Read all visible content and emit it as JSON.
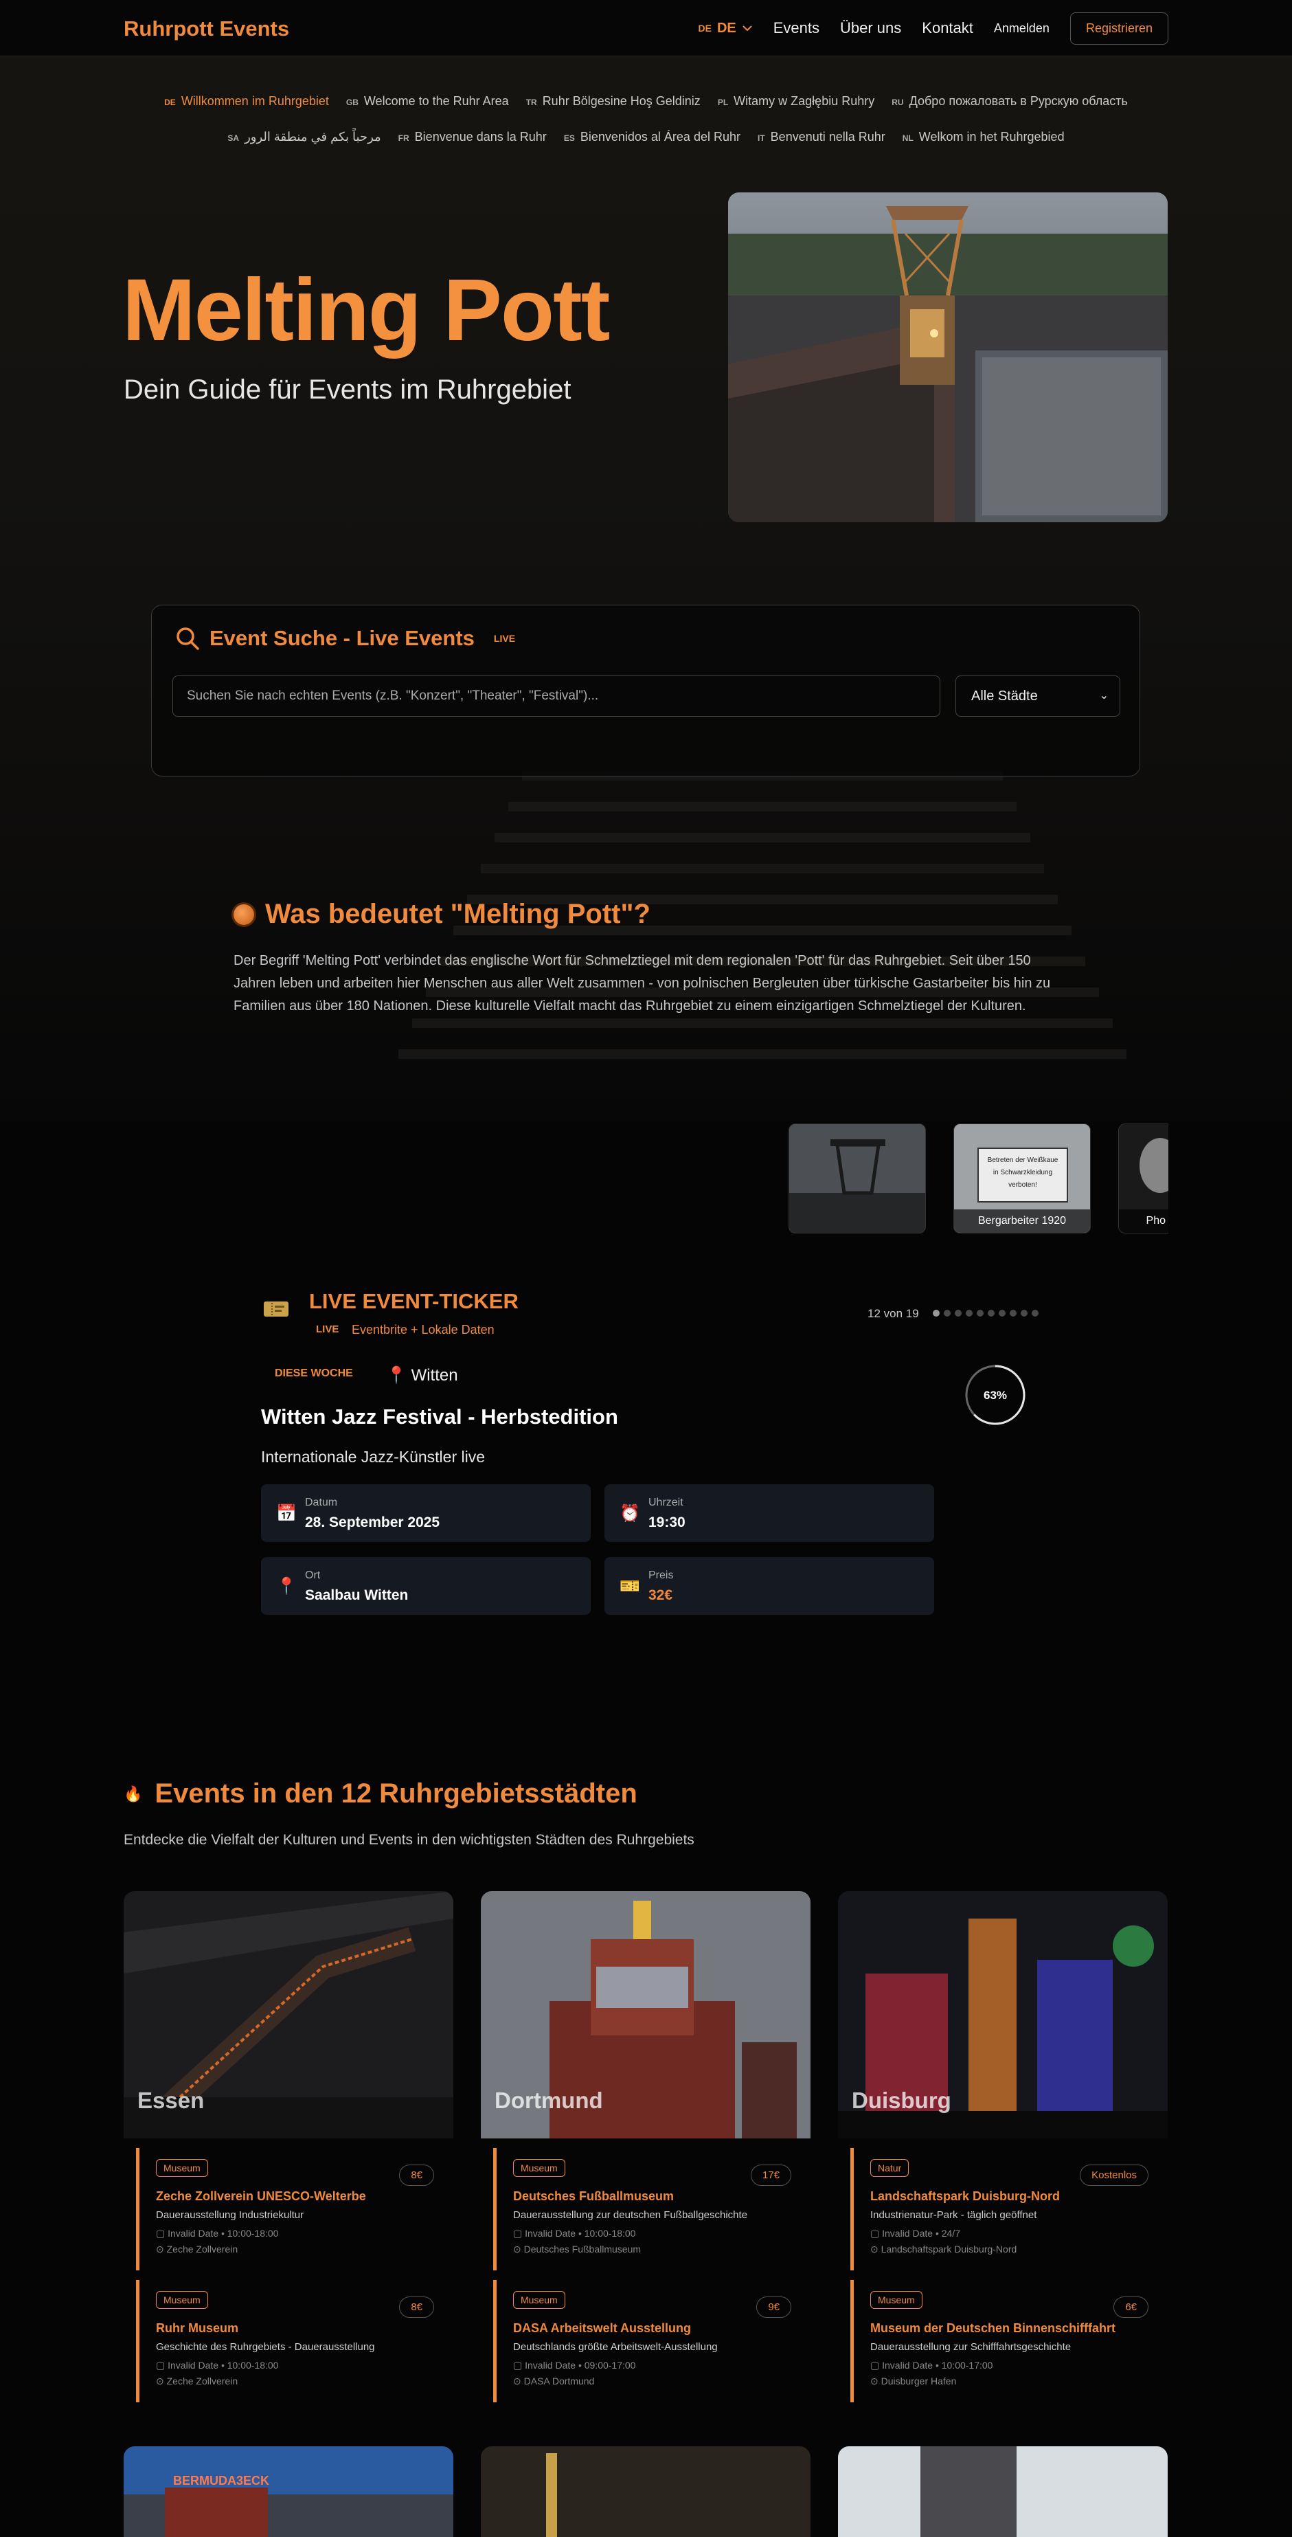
{
  "header": {
    "logo": "Ruhrpott Events",
    "lang_code": "DE",
    "lang_label": "DE",
    "nav": [
      "Events",
      "Über uns",
      "Kontakt"
    ],
    "login": "Anmelden",
    "register": "Registrieren"
  },
  "greetings": [
    {
      "code": "DE",
      "text": "Willkommen im Ruhrgebiet"
    },
    {
      "code": "GB",
      "text": "Welcome to the Ruhr Area"
    },
    {
      "code": "TR",
      "text": "Ruhr Bölgesine Hoş Geldiniz"
    },
    {
      "code": "PL",
      "text": "Witamy w Zagłębiu Ruhry"
    },
    {
      "code": "RU",
      "text": "Добро пожаловать в Рурскую область"
    },
    {
      "code": "SA",
      "text": "مرحباً بكم في منطقة الرور"
    },
    {
      "code": "FR",
      "text": "Bienvenue dans la Ruhr"
    },
    {
      "code": "ES",
      "text": "Bienvenidos al Área del Ruhr"
    },
    {
      "code": "IT",
      "text": "Benvenuti nella Ruhr"
    },
    {
      "code": "NL",
      "text": "Welkom in het Ruhrgebied"
    }
  ],
  "hero": {
    "title": "Melting Pott",
    "subtitle": "Dein Guide für Events im Ruhrgebiet"
  },
  "search": {
    "title": "Event Suche - Live Events",
    "live": "LIVE",
    "placeholder": "Suchen Sie nach echten Events (z.B. \"Konzert\", \"Theater\", \"Festival\")...",
    "city_select": "Alle Städte"
  },
  "meaning": {
    "title": "Was bedeutet \"Melting Pott\"?",
    "text": "Der Begriff 'Melting Pott' verbindet das englische Wort für Schmelztiegel mit dem regionalen 'Pott' für das Ruhrgebiet. Seit über 150 Jahren leben und arbeiten hier Menschen aus aller Welt zusammen - von polnischen Bergleuten über türkische Gastarbeiter bis hin zu Familien aus über 180 Nationen. Diese kulturelle Vielfalt macht das Ruhrgebiet zu einem einzigartigen Schmelztiegel der Kulturen."
  },
  "gallery": {
    "sign_lines": [
      "Betreten der Weißkaue",
      "in Schwarzkleidung",
      "verboten!"
    ],
    "captions": [
      "",
      "Bergarbeiter 1920",
      "Pho"
    ]
  },
  "ticker": {
    "title": "LIVE EVENT-TICKER",
    "live": "LIVE",
    "source": "Eventbrite + Lokale Daten",
    "count": "12 von 19",
    "dots_total": 10,
    "dots_active": 0,
    "week_badge": "DIESE WOCHE",
    "city": "Witten",
    "progress_label": "63%",
    "progress": 0.63,
    "event_title": "Witten Jazz Festival - Herbstedition",
    "event_subtitle": "Internationale Jazz-Künstler live",
    "date_label": "Datum",
    "date_value": "28. September 2025",
    "time_label": "Uhrzeit",
    "time_value": "19:30",
    "place_label": "Ort",
    "place_value": "Saalbau Witten",
    "price_label": "Preis",
    "price_value": "32€"
  },
  "cities": {
    "title": "Events in den 12 Ruhrgebietsstädten",
    "subtitle": "Entdecke die Vielfalt der Kulturen und Events in den wichtigsten Städten des Ruhrgebiets",
    "cards": [
      {
        "name": "Essen",
        "events": [
          {
            "tag": "Museum",
            "price": "8€",
            "name": "Zeche Zollverein UNESCO-Welterbe",
            "desc": "Dauerausstellung Industriekultur",
            "date": "Invalid Date • 10:00-18:00",
            "place": "Zeche Zollverein"
          },
          {
            "tag": "Museum",
            "price": "8€",
            "name": "Ruhr Museum",
            "desc": "Geschichte des Ruhrgebiets - Dauerausstellung",
            "date": "Invalid Date • 10:00-18:00",
            "place": "Zeche Zollverein"
          }
        ]
      },
      {
        "name": "Dortmund",
        "events": [
          {
            "tag": "Museum",
            "price": "17€",
            "name": "Deutsches Fußballmuseum",
            "desc": "Dauerausstellung zur deutschen Fußballgeschichte",
            "date": "Invalid Date • 10:00-18:00",
            "place": "Deutsches Fußballmuseum"
          },
          {
            "tag": "Museum",
            "price": "9€",
            "name": "DASA Arbeitswelt Ausstellung",
            "desc": "Deutschlands größte Arbeitswelt-Ausstellung",
            "date": "Invalid Date • 09:00-17:00",
            "place": "DASA Dortmund"
          }
        ]
      },
      {
        "name": "Duisburg",
        "events": [
          {
            "tag": "Natur",
            "price": "Kostenlos",
            "name": "Landschaftspark Duisburg-Nord",
            "desc": "Industrienatur-Park - täglich geöffnet",
            "date": "Invalid Date • 24/7",
            "place": "Landschaftspark Duisburg-Nord"
          },
          {
            "tag": "Museum",
            "price": "6€",
            "name": "Museum der Deutschen Binnenschifffahrt",
            "desc": "Dauerausstellung zur Schifffahrtsgeschichte",
            "date": "Invalid Date • 10:00-17:00",
            "place": "Duisburger Hafen"
          }
        ]
      }
    ],
    "second_row_sign": "BERMUDA3ECK"
  },
  "colors": {
    "accent": "#f08a3c",
    "bg": "#050505",
    "card": "#151a22"
  }
}
